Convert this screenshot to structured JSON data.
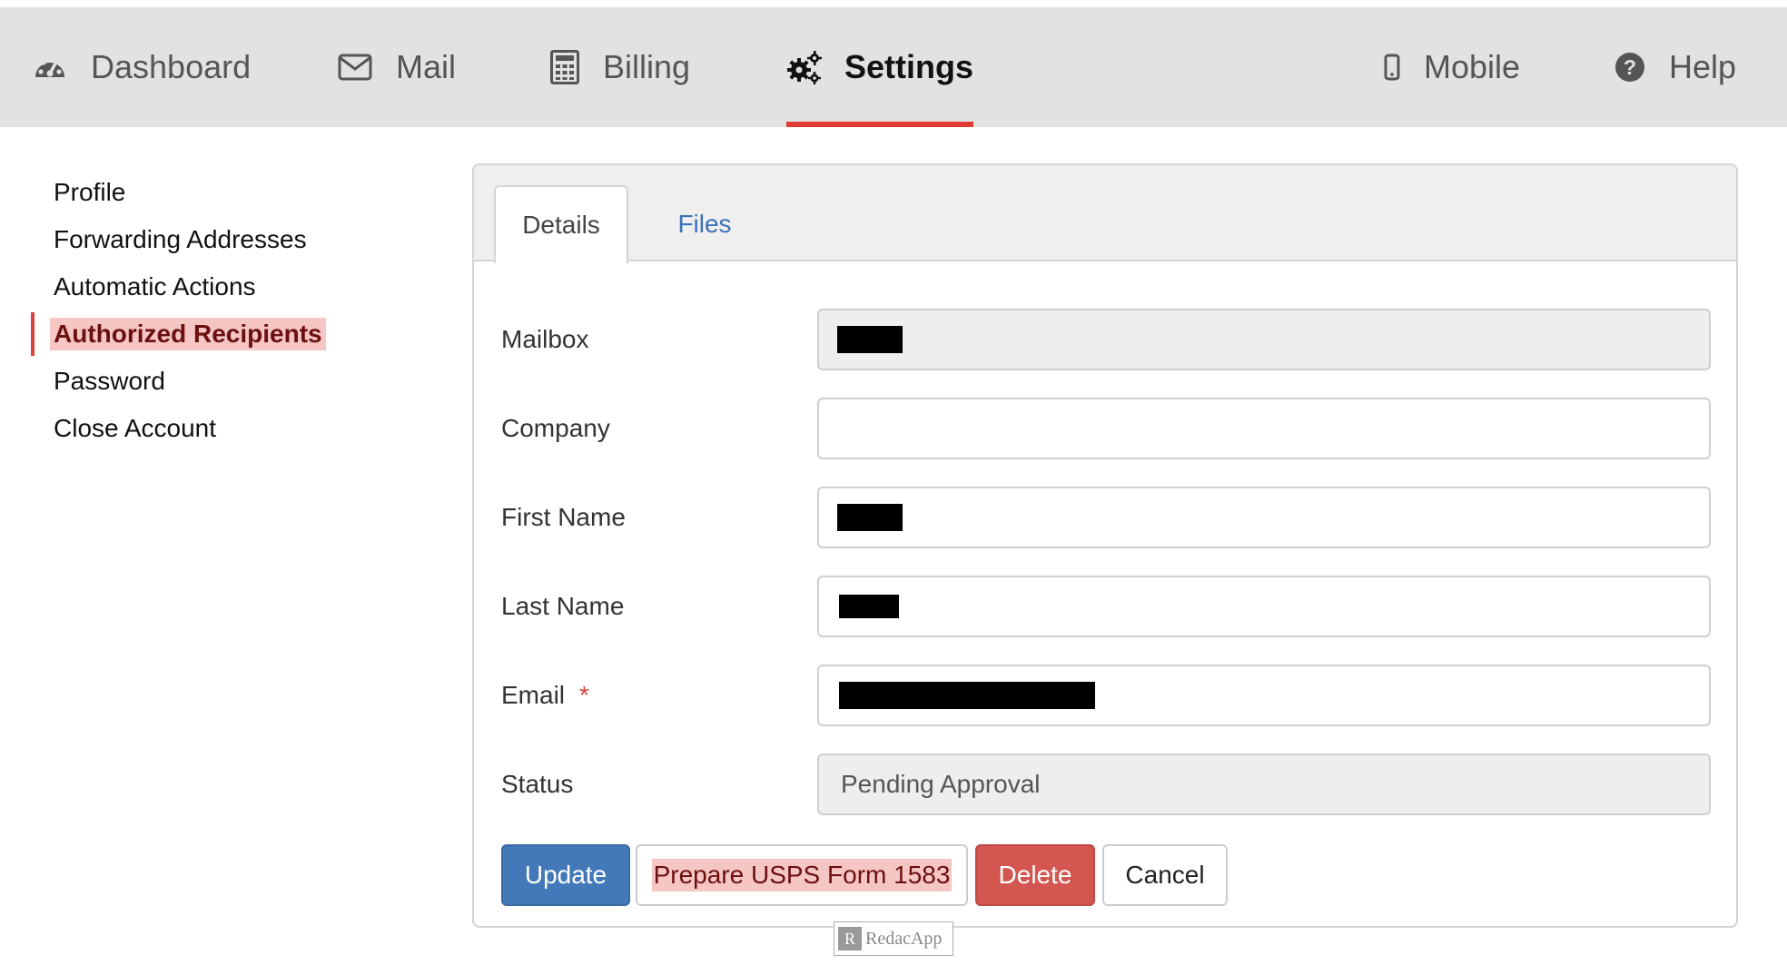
{
  "nav": {
    "items": [
      {
        "label": "Dashboard",
        "icon": "dashboard-icon"
      },
      {
        "label": "Mail",
        "icon": "envelope-icon"
      },
      {
        "label": "Billing",
        "icon": "calculator-icon"
      },
      {
        "label": "Settings",
        "icon": "gears-icon",
        "active": true
      },
      {
        "label": "Mobile",
        "icon": "mobile-phone-icon"
      },
      {
        "label": "Help",
        "icon": "question-circle-icon"
      }
    ],
    "active_color": "#e03a33"
  },
  "sidebar": {
    "items": [
      {
        "label": "Profile"
      },
      {
        "label": "Forwarding Addresses"
      },
      {
        "label": "Automatic Actions"
      },
      {
        "label": "Authorized Recipients",
        "active": true
      },
      {
        "label": "Password"
      },
      {
        "label": "Close Account"
      }
    ]
  },
  "tabs": [
    {
      "label": "Details",
      "active": true
    },
    {
      "label": "Files",
      "active": false
    }
  ],
  "form": {
    "mailbox": {
      "label": "Mailbox",
      "value": "",
      "redacted": true
    },
    "company": {
      "label": "Company",
      "value": ""
    },
    "first_name": {
      "label": "First Name",
      "value": "",
      "redacted": true
    },
    "last_name": {
      "label": "Last Name",
      "value": "",
      "redacted": true
    },
    "email": {
      "label": "Email",
      "required_marker": "*",
      "value": "",
      "redacted": true
    },
    "status": {
      "label": "Status",
      "value": "Pending Approval"
    }
  },
  "buttons": {
    "update": "Update",
    "prepare_form": "Prepare USPS Form 1583",
    "delete": "Delete",
    "cancel": "Cancel"
  },
  "watermark": {
    "logo_letter": "R",
    "text": "RedacApp"
  },
  "colors": {
    "primary": "#4379b8",
    "danger": "#d35650",
    "highlight": "#f6c6c4",
    "link": "#3b73b9"
  }
}
